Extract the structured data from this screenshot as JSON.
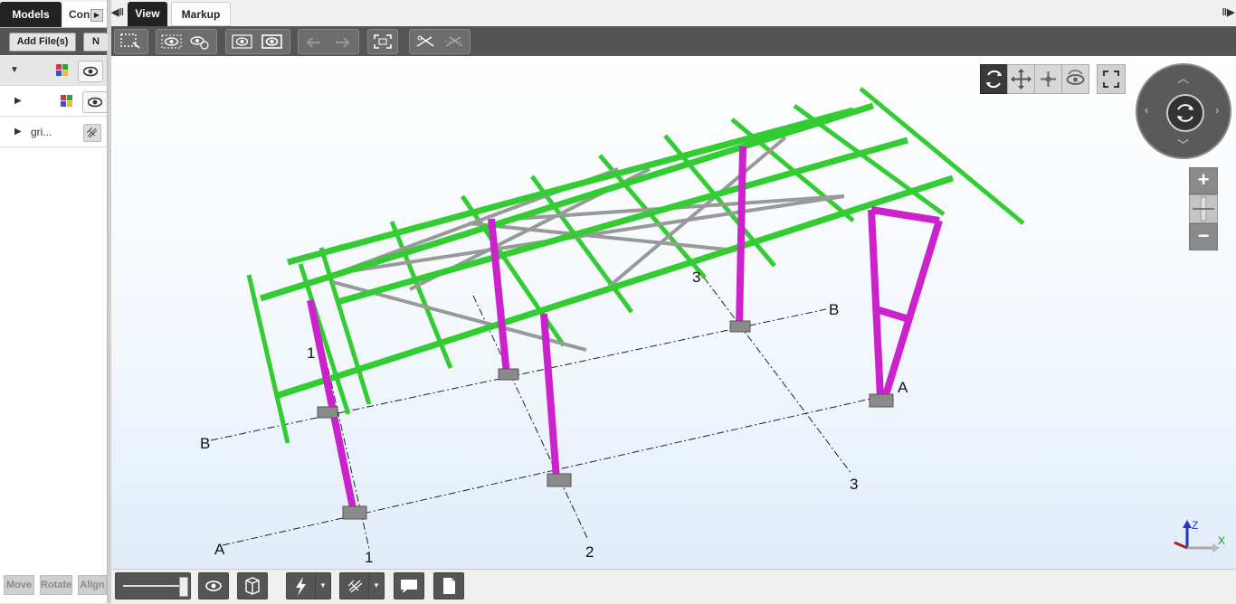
{
  "left_panel": {
    "tabs": [
      "Models",
      "Con"
    ],
    "toolbar": {
      "add_files_label": "Add File(s)",
      "second_button_label": "N"
    },
    "tree": [
      {
        "label": "",
        "expanded": true,
        "has_color_icon": true,
        "has_eye": true
      },
      {
        "label": "",
        "expanded": false,
        "has_color_icon": true,
        "has_eye": true
      },
      {
        "label": "gri...",
        "expanded": false,
        "has_grid_icon": true
      }
    ],
    "bottom_buttons": [
      "Move",
      "Rotate",
      "Align"
    ]
  },
  "main": {
    "tabs": [
      "View",
      "Markup"
    ],
    "active_tab": "View",
    "toolbar_icons": [
      "select-window-icon",
      "hide-icon",
      "hide-others-icon",
      "isolate-icon",
      "show-all-icon",
      "undo-icon",
      "redo-icon",
      "fit-view-icon",
      "clip-icon",
      "clip-off-icon"
    ]
  },
  "viewport": {
    "grid_labels": {
      "A_left": "A",
      "A_right": "A",
      "B_left": "B",
      "B_right": "B",
      "g1_top": "1",
      "g1_bottom": "1",
      "g2_bottom": "2",
      "g3_top": "3",
      "g3_bottom": "3"
    },
    "axes": {
      "z": "Z",
      "x": "X"
    },
    "nav_modes": [
      "orbit-icon",
      "pan-icon",
      "walk-icon",
      "look-icon"
    ],
    "zoom": {
      "plus": "+",
      "minus": "−"
    },
    "colors": {
      "beam": "#33cc33",
      "column": "#cc22cc",
      "bracing": "#999999",
      "footing": "#8a8a8a"
    }
  },
  "bottom_bar": {
    "icons": [
      "quality-slider",
      "visibility-icon",
      "box-view-icon",
      "lightning-icon",
      "grid-icon",
      "comment-icon",
      "note-icon"
    ]
  }
}
